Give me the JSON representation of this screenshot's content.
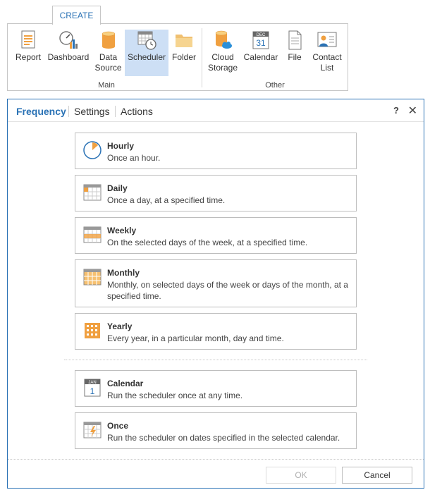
{
  "ribbon": {
    "tab_label": "CREATE",
    "main_group_label": "Main",
    "other_group_label": "Other",
    "buttons": {
      "report": "Report",
      "dashboard": "Dashboard",
      "data_source_1": "Data",
      "data_source_2": "Source",
      "scheduler": "Scheduler",
      "folder": "Folder",
      "cloud_storage_1": "Cloud",
      "cloud_storage_2": "Storage",
      "calendar": "Calendar",
      "calendar_month": "DEC",
      "calendar_day": "31",
      "file": "File",
      "contact_list_1": "Contact",
      "contact_list_2": "List"
    }
  },
  "dialog": {
    "tabs": [
      "Frequency",
      "Settings",
      "Actions"
    ],
    "help": "?",
    "close": "✕",
    "options": [
      {
        "title": "Hourly",
        "desc": "Once an hour."
      },
      {
        "title": "Daily",
        "desc": "Once a day, at a specified time."
      },
      {
        "title": "Weekly",
        "desc": "On the selected days of the week, at a specified time."
      },
      {
        "title": "Monthly",
        "desc": "Monthly, on selected days of the week or days of the month, at a specified time."
      },
      {
        "title": "Yearly",
        "desc": "Every year, in a particular month, day and time."
      },
      {
        "title": "Calendar",
        "desc": "Run the scheduler once at any time."
      },
      {
        "title": "Once",
        "desc": "Run the scheduler on dates specified in the selected calendar."
      }
    ],
    "calendar_icon_month": "JAN",
    "calendar_icon_day": "1",
    "ok_label": "OK",
    "cancel_label": "Cancel"
  },
  "colors": {
    "accent": "#2a72b5",
    "selected_bg": "#cddff5",
    "orange": "#f0a040",
    "border": "#bdbdbd"
  }
}
